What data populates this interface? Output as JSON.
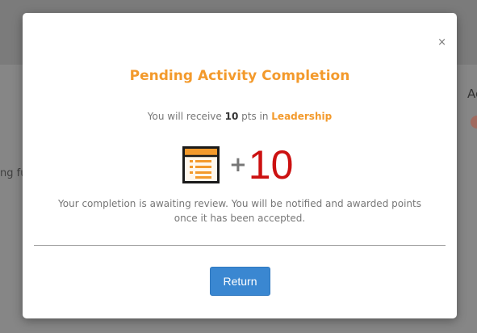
{
  "background": {
    "text_fragment": "ng fu",
    "side_text": "Ac"
  },
  "modal": {
    "close_label": "×",
    "title": "Pending Activity Completion",
    "receive": {
      "prefix": "You will receive",
      "points": "10",
      "unit": "pts in",
      "category": "Leadership"
    },
    "points_display": {
      "icon": "activity-list-icon",
      "plus": "+",
      "amount": "10"
    },
    "message": "Your completion is awaiting review. You will be notified and awarded points once it has been accepted.",
    "return_label": "Return"
  },
  "colors": {
    "accent_orange": "#f39a2c",
    "points_red": "#cc1111",
    "button_blue": "#3a87d1"
  }
}
